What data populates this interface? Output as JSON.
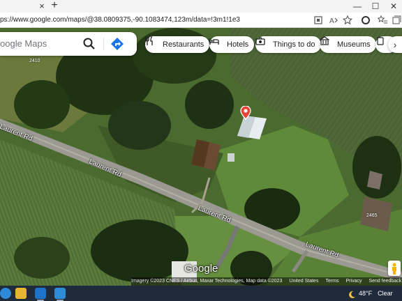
{
  "browser": {
    "tab_close": "×",
    "new_tab": "+",
    "window_controls": {
      "minimize": "—",
      "maximize": "☐",
      "close": "✕"
    },
    "url": "ps://www.google.com/maps/@38.0809375,-90.1083474,123m/data=!3m1!1e3",
    "toolbar_icons": [
      "app-icon",
      "read-aloud-icon",
      "favorite-icon",
      "extensions-icon",
      "favorites-bar-icon",
      "collections-icon"
    ]
  },
  "map": {
    "search": {
      "placeholder": "oogle Maps"
    },
    "chips": [
      {
        "label": "Restaurants",
        "icon": "fork-knife-icon"
      },
      {
        "label": "Hotels",
        "icon": "bed-icon"
      },
      {
        "label": "Things to do",
        "icon": "camera-icon"
      },
      {
        "label": "Museums",
        "icon": "museum-icon"
      }
    ],
    "chip_more": "›",
    "road_labels": [
      "Laurent Rd",
      "Laurent Rd",
      "Laurent Rd",
      "Laurent Rd"
    ],
    "house_numbers": [
      "2465",
      "2410"
    ],
    "logo": "Google",
    "attribution": {
      "imagery": "Imagery ©2023 CNES / Airbus, Maxar Technologies, Map data ©2023",
      "region": "United States",
      "terms": "Terms",
      "privacy": "Privacy",
      "feedback": "Send feedback"
    },
    "colors": {
      "pin": "#ea4335",
      "directions": "#1a73e8"
    }
  },
  "taskbar": {
    "weather_temp": "48°F",
    "weather_desc": "Clear"
  }
}
